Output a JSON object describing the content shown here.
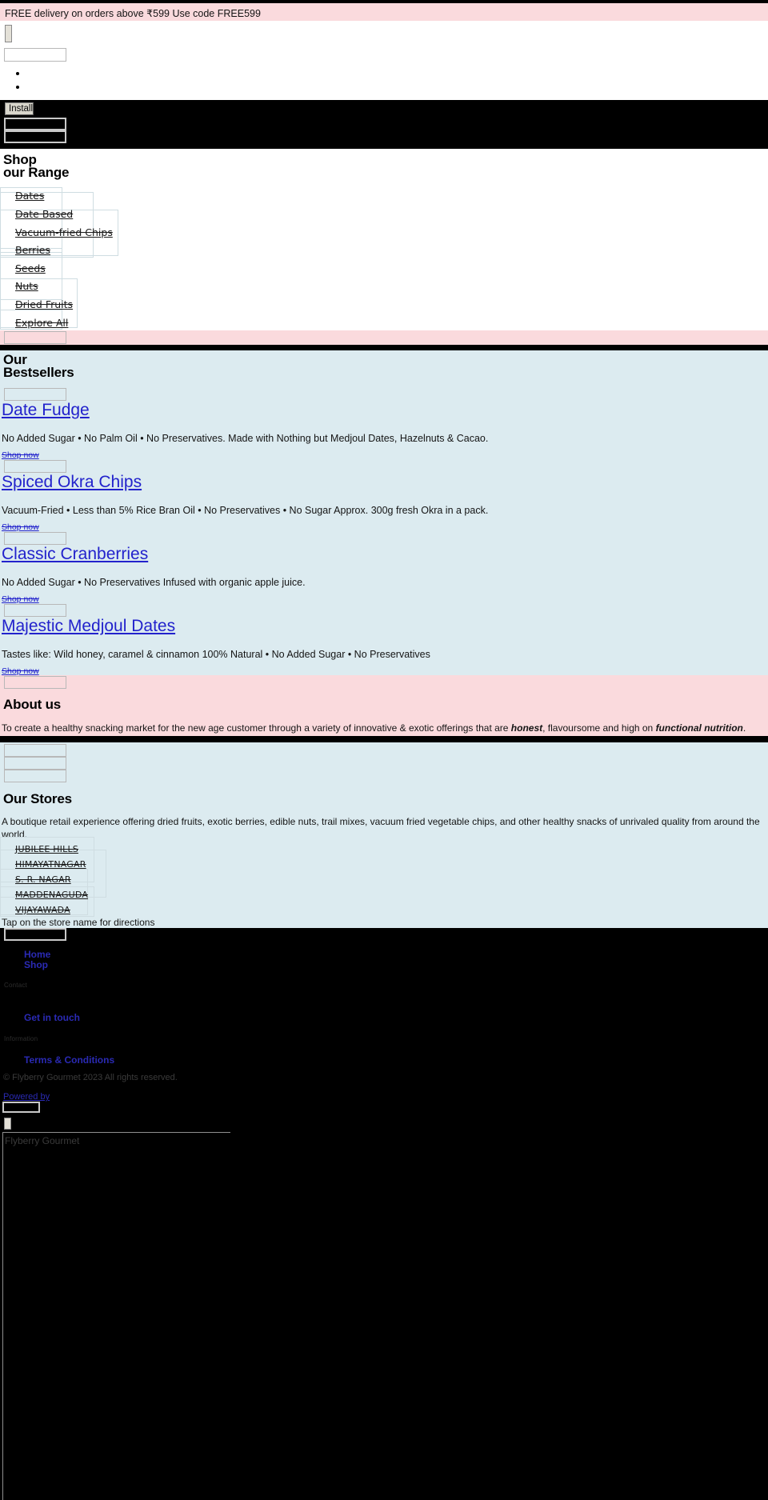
{
  "page": {
    "site_name": "Flyberry Gourmet",
    "colors": {
      "promo_bg": "#fadadd",
      "section_bg": "#dcebf0",
      "page_bg": "#000000",
      "link": "#2222cc"
    }
  },
  "promo": {
    "text": "FREE delivery on orders above ₹599 Use code FREE599"
  },
  "header": {
    "install_label": "Install",
    "nav_bullets": [
      "",
      ""
    ]
  },
  "shop_range": {
    "heading_line1": "Shop",
    "heading_line2": "our Range",
    "categories": [
      {
        "label": "Dates"
      },
      {
        "label": "Date Based"
      },
      {
        "label": "Vacuum-fried Chips"
      },
      {
        "label": "Berries"
      },
      {
        "label": "Seeds"
      },
      {
        "label": "Nuts"
      },
      {
        "label": "Dried Fruits"
      },
      {
        "label": "Explore All"
      }
    ]
  },
  "bestsellers": {
    "heading_line1": "Our",
    "heading_line2": "Bestsellers",
    "cta_label": "Shop now",
    "products": [
      {
        "name": "Date Fudge",
        "description": "No Added Sugar • No Palm Oil • No Preservatives. Made with Nothing but Medjoul Dates, Hazelnuts & Cacao."
      },
      {
        "name": "Spiced Okra Chips",
        "description": "Vacuum-Fried • Less than 5% Rice Bran Oil • No Preservatives • No Sugar Approx. 300g fresh Okra in a pack."
      },
      {
        "name": "Classic Cranberries",
        "description": "No Added Sugar • No Preservatives Infused with organic apple juice."
      },
      {
        "name": "Majestic Medjoul Dates",
        "description": "Tastes like: Wild honey, caramel & cinnamon 100% Natural • No Added Sugar • No Preservatives"
      }
    ]
  },
  "about": {
    "heading": "About us",
    "text_part1": "To create a healthy snacking market for the new age customer through a variety of innovative & exotic offerings that are ",
    "emphasis1": "honest",
    "text_part2": ", flavoursome and high on ",
    "emphasis2": "functional nutrition",
    "text_part3": "."
  },
  "stores": {
    "heading": "Our Stores",
    "description": "A boutique retail experience offering dried fruits, exotic berries, edible nuts, trail mixes, vacuum fried vegetable chips, and other healthy snacks of unrivaled quality from around the world.",
    "locations": [
      {
        "label": "JUBILEE HILLS"
      },
      {
        "label": "HIMAYATNAGAR"
      },
      {
        "label": "S. R. NAGAR"
      },
      {
        "label": "MADDENAGUDA"
      },
      {
        "label": "VIJAYAWADA"
      }
    ],
    "note": "Tap on the store name for directions"
  },
  "footer": {
    "nav_links": [
      {
        "label": "Home"
      },
      {
        "label": "Shop"
      }
    ],
    "contact_heading": "Contact",
    "contact_link": "Get in touch",
    "information_heading": "Information",
    "information_link": "Terms & Conditions",
    "copyright": "© Flyberry Gourmet 2023 All rights reserved.",
    "powered_by": "Powered by",
    "brand": "Flyberry Gourmet"
  }
}
